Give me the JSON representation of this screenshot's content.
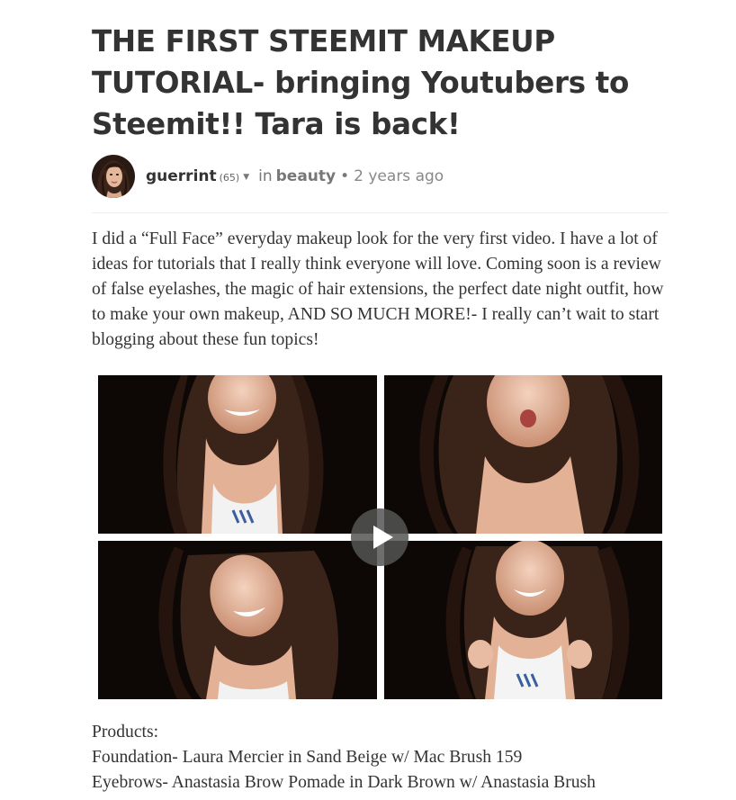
{
  "post": {
    "title": "THE FIRST STEEMIT MAKEUP TUTORIAL- bringing Youtubers to Steemit!! Tara is back!",
    "author": "guerrint",
    "reputation": "(65)",
    "caret_icon": "caret-down-icon",
    "in_label": "in",
    "category": "beauty",
    "separator": "•",
    "timestamp": "2 years ago",
    "intro": "I did a “Full Face” everyday makeup look for the very first video. I have a lot of ideas for tutorials that I really think everyone will love. Coming soon is a review of false eyelashes, the magic of hair extensions, the perfect date night outfit, how to make your own makeup, AND SO MUCH MORE!- I really can’t wait to start blogging about these fun topics!",
    "video": {
      "play_icon": "play-icon"
    },
    "products": {
      "heading": "Products:",
      "lines": [
        "Foundation- Laura Mercier in Sand Beige w/ Mac Brush 159",
        "Eyebrows- Anastasia Brow Pomade in Dark Brown w/ Anastasia Brush"
      ]
    }
  },
  "colors": {
    "title": "#333333",
    "meta": "#777777",
    "play_button": "#555555"
  }
}
